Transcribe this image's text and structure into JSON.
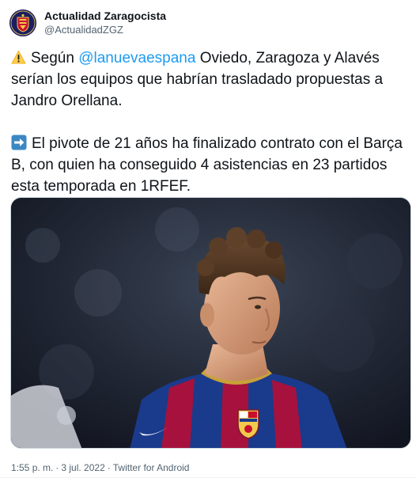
{
  "account": {
    "display_name": "Actualidad Zaragocista",
    "handle": "@ActualidadZGZ",
    "avatar_icon": "club-crest-icon"
  },
  "tweet": {
    "para1": {
      "emoji": "warning-icon",
      "before": "Según ",
      "mention": "@lanuevaespana",
      "after": " Oviedo, Zaragoza y Alavés serían los equipos que habrían trasladado propuestas a Jandro Orellana."
    },
    "para2": {
      "emoji": "right-arrow-icon",
      "text": "El pivote de 21 años ha finalizado contrato con el Barça B, con quien ha conseguido 4 asistencias en 23 partidos esta temporada en 1RFEF."
    },
    "media": {
      "icon": "player-photo"
    }
  },
  "meta": {
    "time": "1:55 p. m.",
    "separator": "·",
    "date": "3 jul. 2022",
    "source": "Twitter for Android"
  },
  "colors": {
    "link": "#1d9bf0",
    "secondary_text": "#536471",
    "primary_text": "#0f1419"
  }
}
